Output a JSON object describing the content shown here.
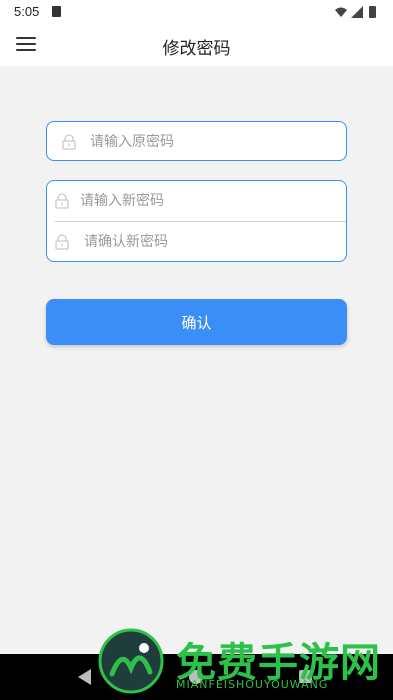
{
  "status_bar": {
    "time": "5:05"
  },
  "header": {
    "title": "修改密码",
    "menu_icon": "hamburger-menu-icon"
  },
  "form": {
    "old_password": {
      "placeholder": "请输入原密码",
      "value": ""
    },
    "new_password": {
      "placeholder": "请输入新密码",
      "value": ""
    },
    "confirm_password": {
      "placeholder": "请确认新密码",
      "value": ""
    },
    "submit_label": "确认"
  },
  "watermark": {
    "title": "免费手游网",
    "subtitle": "MIANFEISHOUYOUWANG"
  },
  "colors": {
    "accent": "#3a8ef6",
    "background": "#f2f2f2",
    "watermark": "#2ec14a"
  }
}
